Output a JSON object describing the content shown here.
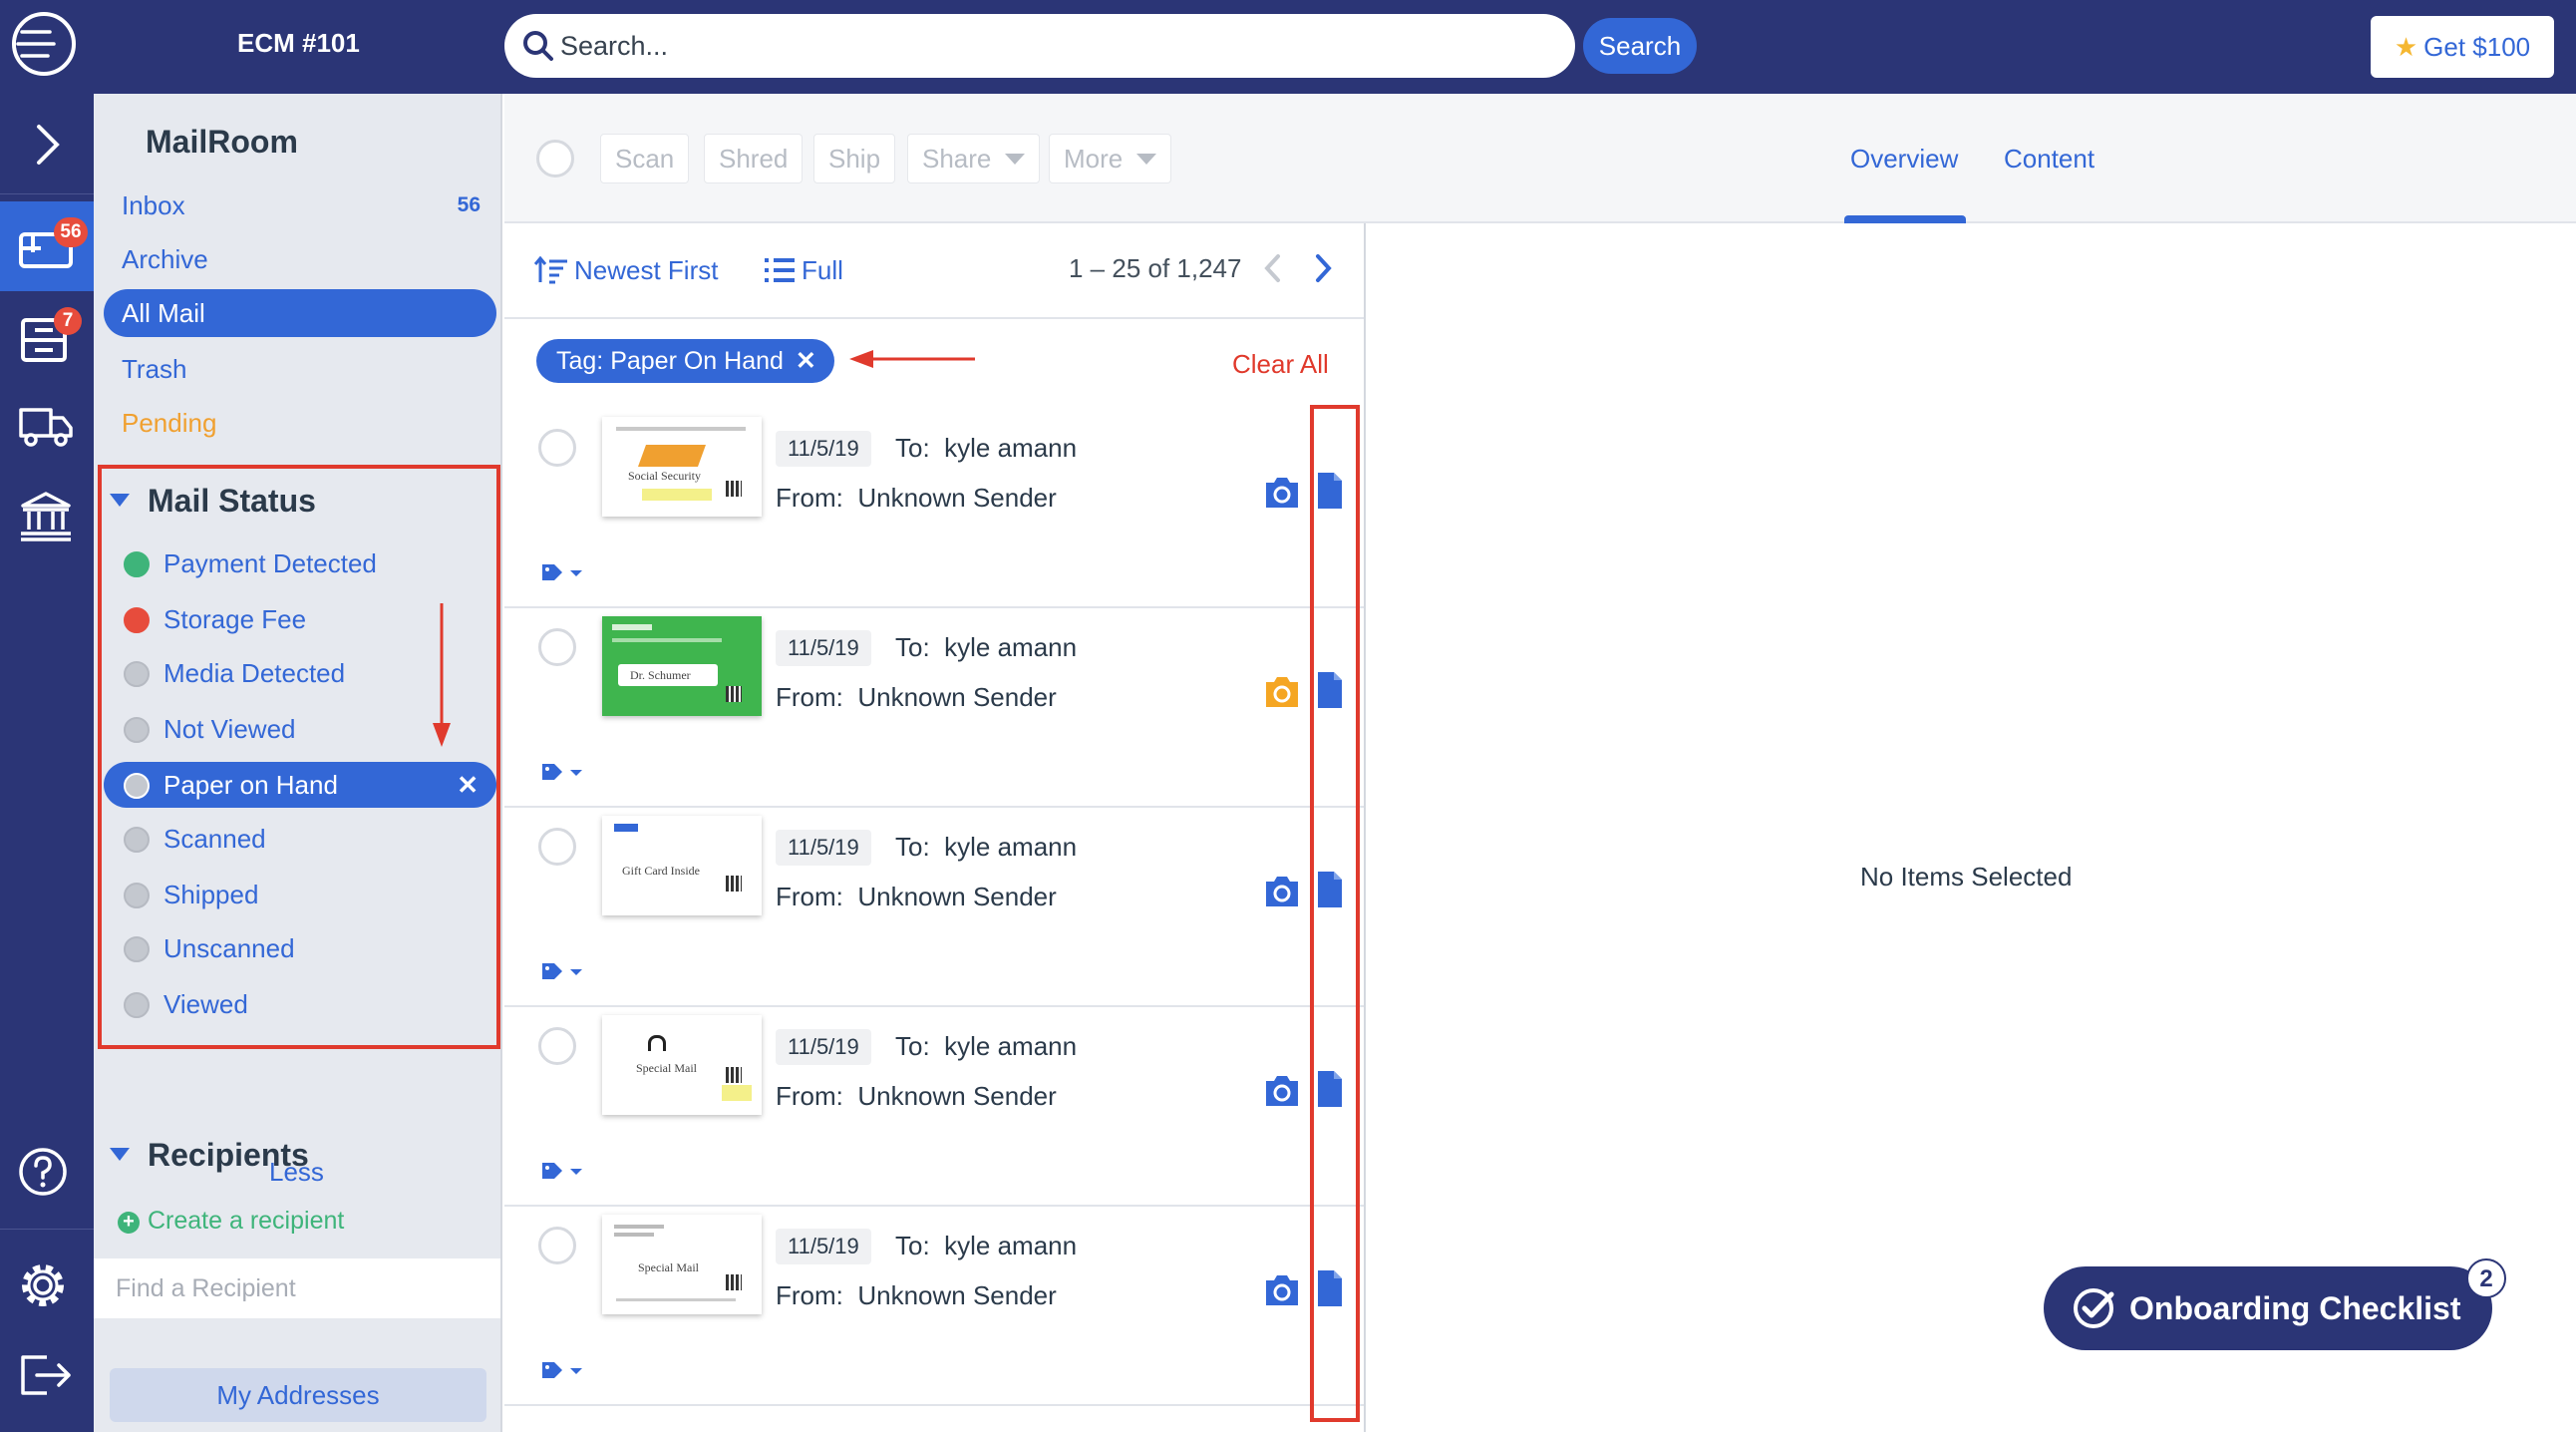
{
  "header": {
    "account_label": "ECM #101",
    "search_placeholder": "Search...",
    "search_button": "Search",
    "promo_button": "Get $100"
  },
  "rail": {
    "mail_badge": "56",
    "packages_badge": "7"
  },
  "sidebar": {
    "title": "MailRoom",
    "folders": [
      {
        "label": "Inbox",
        "count": "56"
      },
      {
        "label": "Archive"
      },
      {
        "label": "All Mail"
      },
      {
        "label": "Trash"
      },
      {
        "label": "Pending"
      }
    ],
    "mail_status": {
      "heading": "Mail Status",
      "items": [
        {
          "label": "Payment Detected",
          "color": "#3eb47a"
        },
        {
          "label": "Storage Fee",
          "color": "#e74c3c"
        },
        {
          "label": "Media Detected",
          "color": "#c4c8cf"
        },
        {
          "label": "Not Viewed",
          "color": "#c4c8cf"
        },
        {
          "label": "Paper on Hand",
          "color": "#c4c8cf"
        },
        {
          "label": "Scanned",
          "color": "#c4c8cf"
        },
        {
          "label": "Shipped",
          "color": "#c4c8cf"
        },
        {
          "label": "Unscanned",
          "color": "#c4c8cf"
        },
        {
          "label": "Viewed",
          "color": "#c4c8cf"
        }
      ],
      "less_label": "Less"
    },
    "recipients": {
      "heading": "Recipients",
      "create_label": "Create a recipient",
      "find_placeholder": "Find a Recipient"
    },
    "my_addresses": "My Addresses"
  },
  "toolbar": {
    "buttons": [
      "Scan",
      "Shred",
      "Ship",
      "Share",
      "More"
    ],
    "tabs": [
      "Overview",
      "Content"
    ]
  },
  "list": {
    "sort_label": "Newest First",
    "view_label": "Full",
    "pagination": "1 – 25 of 1,247",
    "filter_chip": "Tag: Paper On Hand",
    "clear_all": "Clear All",
    "rows": [
      {
        "date": "11/5/19",
        "to_label": "To:",
        "to": "kyle amann",
        "from_label": "From:",
        "from": "Unknown Sender",
        "thumb_text": "Social Security",
        "camera_color": "#3367d6"
      },
      {
        "date": "11/5/19",
        "to_label": "To:",
        "to": "kyle amann",
        "from_label": "From:",
        "from": "Unknown Sender",
        "thumb_text": "Dr. Schumer",
        "camera_color": "#f5a623"
      },
      {
        "date": "11/5/19",
        "to_label": "To:",
        "to": "kyle amann",
        "from_label": "From:",
        "from": "Unknown Sender",
        "thumb_text": "Gift Card Inside",
        "camera_color": "#3367d6"
      },
      {
        "date": "11/5/19",
        "to_label": "To:",
        "to": "kyle amann",
        "from_label": "From:",
        "from": "Unknown Sender",
        "thumb_text": "Special Mail",
        "camera_color": "#3367d6"
      },
      {
        "date": "11/5/19",
        "to_label": "To:",
        "to": "kyle amann",
        "from_label": "From:",
        "from": "Unknown Sender",
        "thumb_text": "Special Mail",
        "camera_color": "#3367d6"
      }
    ]
  },
  "detail": {
    "empty_text": "No Items Selected",
    "onboarding_label": "Onboarding Checklist",
    "onboarding_badge": "2"
  },
  "colors": {
    "navy": "#2b3576",
    "accent": "#3367d6",
    "annotation_red": "#e03a2d",
    "pending_orange": "#f0a030"
  }
}
